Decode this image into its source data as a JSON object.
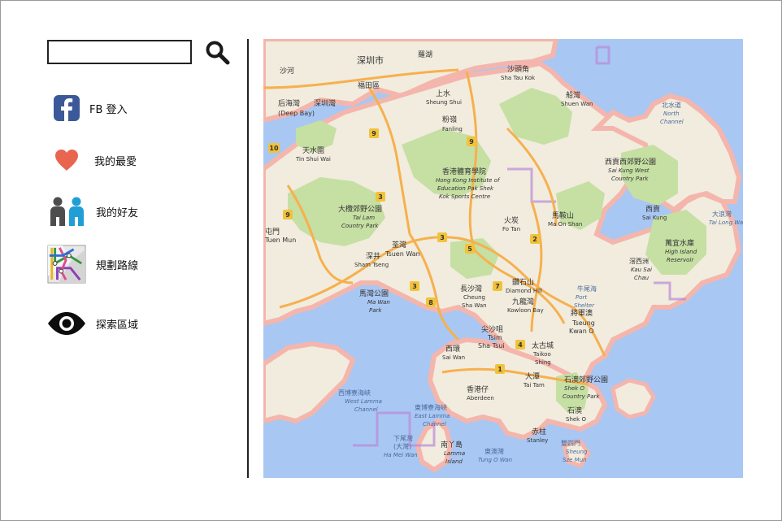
{
  "search": {
    "value": "",
    "placeholder": ""
  },
  "menu": [
    {
      "label": "FB 登入",
      "icon": "facebook-icon"
    },
    {
      "label": "我的最愛",
      "icon": "heart-icon"
    },
    {
      "label": "我的好友",
      "icon": "friends-icon"
    },
    {
      "label": "規劃路線",
      "icon": "route-icon"
    },
    {
      "label": "探索區域",
      "icon": "eye-icon"
    }
  ],
  "map": {
    "labels": {
      "shenzhen": "深圳市",
      "fuzhou": "福田區",
      "shenzhen_bay": "深圳灣",
      "houhai_bay": "后海灣",
      "deep_bay": "(Deep Bay)",
      "shatoujiao": "沙頭角",
      "shatoujiao_en": "Sha Tau Kok",
      "shangshui": "上水",
      "shangshui_en": "Sheung Shui",
      "fanling": "粉嶺",
      "fanling_en": "Fanling",
      "tin_shui_wai": "天水圍",
      "tin_shui_wai_en": "Tin Shui Wai",
      "tai_lam": "大欖郊野公園",
      "tai_lam_en1": "Tai Lam",
      "tai_lam_en2": "Country Park",
      "sports_centre": "香港體育學院",
      "sports_centre_en1": "Hong Kong Institute of",
      "sports_centre_en2": "Education Pak Shek",
      "sports_centre_en3": "Kok Sports Centre",
      "tuen_mun": "屯門",
      "tuen_mun_en": "Tuen Mun",
      "tsuen_wan": "荃灣",
      "tsuen_wan_en": "Tsuen Wan",
      "fo_tan": "火炭",
      "fo_tan_en": "Fo Tan",
      "ma_on_shan": "馬鞍山",
      "ma_on_shan_en": "Ma On Shan",
      "shuen_wan": "船灣",
      "shuen_wan_en": "Shuen Wan",
      "sai_kung_west": "西貢西郊野公園",
      "sai_kung_west_en1": "Sai Kung West",
      "sai_kung_west_en2": "Country Park",
      "sai_kung": "西貢",
      "sai_kung_en": "Sai Kung",
      "tai_long_wan": "大浪灣",
      "tai_long_wan_en": "Tai Long Wan",
      "high_island": "萬宜水庫",
      "high_island_en1": "High Island",
      "high_island_en2": "Reservoir",
      "kau_sai": "滘西洲",
      "kau_sai_en1": "Kau Sai",
      "kau_sai_en2": "Chau",
      "north_channel": "北水道",
      "north_channel_en1": "North",
      "north_channel_en2": "Channel",
      "ma_wan": "馬灣公園",
      "ma_wan_en1": "Ma Wan",
      "ma_wan_en2": "Park",
      "cheung_sha_wan": "長沙灣",
      "cheung_sha_wan_en1": "Cheung",
      "cheung_sha_wan_en2": "Sha Wan",
      "diamond_hill": "鑽石山",
      "diamond_hill_en": "Diamond Hill",
      "kowloon_bay": "九龍灣",
      "kowloon_bay_en": "Kowloon Bay",
      "tsim_sha_tsui": "尖沙咀",
      "tsim_sha_tsui_en1": "Tsim",
      "tsim_sha_tsui_en2": "Sha Tsui",
      "sai_wan": "西環",
      "sai_wan_en": "Sai Wan",
      "tai_koo": "太古城",
      "tai_koo_en1": "Taikoo",
      "tai_koo_en2": "Shing",
      "tai_tam": "大潭",
      "tai_tam_en": "Tai Tam",
      "shek_o_cp": "石澳郊野公園",
      "shek_o_cp_en1": "Shek O",
      "shek_o_cp_en2": "Country Park",
      "shek_o": "石澳",
      "shek_o_en": "Shek O",
      "aberdeen": "香港仔",
      "aberdeen_en": "Aberdeen",
      "stanley": "赤柱",
      "stanley_en": "Stanley",
      "west_lamma": "西博寮海峽",
      "west_lamma_en1": "West Lamma",
      "west_lamma_en2": "Channel",
      "east_lamma": "東博寮海峽",
      "east_lamma_en1": "East Lamma",
      "east_lamma_en2": "Channel",
      "lamma": "南丫島",
      "lamma_en1": "Lamma",
      "lamma_en2": "Island",
      "ha_mei_wan": "下尾灣",
      "ha_mei_wan2": "(大灣)",
      "ha_mei_wan_en": "Ha Mei Wan",
      "tung_o_wan": "東澳灣",
      "tung_o_wan_en": "Tung O Wan",
      "sheung_sze_mun": "雙四門",
      "sheung_sze_mun_en1": "Sheung",
      "sheung_sze_mun_en2": "Sze Mun",
      "ngau_mei_hoi": "牛尾海",
      "ngau_mei_hoi_en1": "Port",
      "ngau_mei_hoi_en2": "Shelter",
      "junk_bay": "將軍澳",
      "junk_bay_en1": "Tseung",
      "junk_bay_en2": "Kwan O",
      "sham_tseng": "深井",
      "sham_tseng_en": "Sham Tseng",
      "shenzhen_bay_cn": "深圳灣",
      "sanwang": "沙河",
      "luohu": "羅湖"
    },
    "route_shields": [
      "9",
      "9",
      "3",
      "10",
      "9",
      "2",
      "7",
      "5",
      "3",
      "8",
      "1",
      "4",
      "3"
    ]
  },
  "colors": {
    "land": "#f1ecde",
    "water": "#a9c7f3",
    "park": "#c6dfa3",
    "border_pink": "#f4b6ac",
    "road": "#f7b04d"
  }
}
